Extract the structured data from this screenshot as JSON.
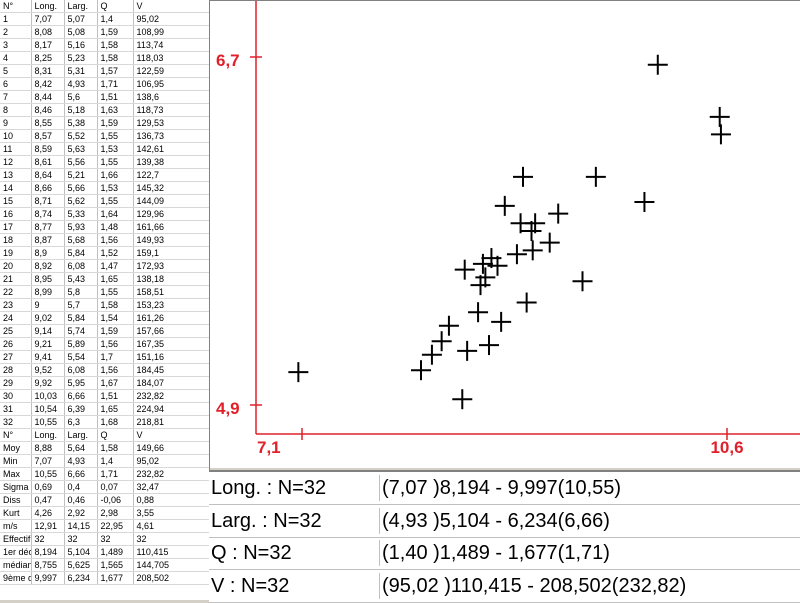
{
  "table": {
    "header": [
      "N°",
      "Long.",
      "Larg.",
      "Q",
      "V"
    ],
    "rows": [
      [
        "1",
        "7,07",
        "5,07",
        "1,4",
        "95,02"
      ],
      [
        "2",
        "8,08",
        "5,08",
        "1,59",
        "108,99"
      ],
      [
        "3",
        "8,17",
        "5,16",
        "1,58",
        "113,74"
      ],
      [
        "4",
        "8,25",
        "5,23",
        "1,58",
        "118,03"
      ],
      [
        "5",
        "8,31",
        "5,31",
        "1,57",
        "122,59"
      ],
      [
        "6",
        "8,42",
        "4,93",
        "1,71",
        "106,95"
      ],
      [
        "7",
        "8,44",
        "5,6",
        "1,51",
        "138,6"
      ],
      [
        "8",
        "8,46",
        "5,18",
        "1,63",
        "118,73"
      ],
      [
        "9",
        "8,55",
        "5,38",
        "1,59",
        "129,53"
      ],
      [
        "10",
        "8,57",
        "5,52",
        "1,55",
        "136,73"
      ],
      [
        "11",
        "8,59",
        "5,63",
        "1,53",
        "142,61"
      ],
      [
        "12",
        "8,61",
        "5,56",
        "1,55",
        "139,38"
      ],
      [
        "13",
        "8,64",
        "5,21",
        "1,66",
        "122,7"
      ],
      [
        "14",
        "8,66",
        "5,66",
        "1,53",
        "145,32"
      ],
      [
        "15",
        "8,71",
        "5,62",
        "1,55",
        "144,09"
      ],
      [
        "16",
        "8,74",
        "5,33",
        "1,64",
        "129,96"
      ],
      [
        "17",
        "8,77",
        "5,93",
        "1,48",
        "161,66"
      ],
      [
        "18",
        "8,87",
        "5,68",
        "1,56",
        "149,93"
      ],
      [
        "19",
        "8,9",
        "5,84",
        "1,52",
        "159,1"
      ],
      [
        "20",
        "8,92",
        "6,08",
        "1,47",
        "172,93"
      ],
      [
        "21",
        "8,95",
        "5,43",
        "1,65",
        "138,18"
      ],
      [
        "22",
        "8,99",
        "5,8",
        "1,55",
        "158,51"
      ],
      [
        "23",
        "9",
        "5,7",
        "1,58",
        "153,23"
      ],
      [
        "24",
        "9,02",
        "5,84",
        "1,54",
        "161,26"
      ],
      [
        "25",
        "9,14",
        "5,74",
        "1,59",
        "157,66"
      ],
      [
        "26",
        "9,21",
        "5,89",
        "1,56",
        "167,35"
      ],
      [
        "27",
        "9,41",
        "5,54",
        "1,7",
        "151,16"
      ],
      [
        "28",
        "9,52",
        "6,08",
        "1,56",
        "184,45"
      ],
      [
        "29",
        "9,92",
        "5,95",
        "1,67",
        "184,07"
      ],
      [
        "30",
        "10,03",
        "6,66",
        "1,51",
        "232,82"
      ],
      [
        "31",
        "10,54",
        "6,39",
        "1,65",
        "224,94"
      ],
      [
        "32",
        "10,55",
        "6,3",
        "1,68",
        "218,81"
      ]
    ],
    "header2": [
      "N°",
      "Long.",
      "Larg.",
      "Q",
      "V"
    ],
    "stats": [
      [
        "Moy",
        "8,88",
        "5,64",
        "1,58",
        "149,66"
      ],
      [
        "Min",
        "7,07",
        "4,93",
        "1,4",
        "95,02"
      ],
      [
        "Max",
        "10,55",
        "6,66",
        "1,71",
        "232,82"
      ],
      [
        "Sigma",
        "0,69",
        "0,4",
        "0,07",
        "32,47"
      ],
      [
        "Diss",
        "0,47",
        "0,46",
        "-0,06",
        "0,88"
      ],
      [
        "Kurt",
        "4,26",
        "2,92",
        "2,98",
        "3,55"
      ],
      [
        "m/s",
        "12,91",
        "14,15",
        "22,95",
        "4,61"
      ],
      [
        "Effectif =",
        "32",
        "32",
        "32",
        "32"
      ],
      [
        "1er décile",
        "8,194",
        "5,104",
        "1,489",
        "110,415"
      ],
      [
        "médiane",
        "8,755",
        "5,625",
        "1,565",
        "144,705"
      ],
      [
        "9ème décile",
        "9,997",
        "6,234",
        "1,677",
        "208,502"
      ]
    ]
  },
  "chart_data": {
    "type": "scatter",
    "x_tick_labels": [
      "7,1",
      "10,6"
    ],
    "y_tick_labels": [
      "6,7",
      "4,9"
    ],
    "xlim": [
      7.1,
      10.6
    ],
    "ylim": [
      4.9,
      6.7
    ],
    "x": [
      7.07,
      8.08,
      8.17,
      8.25,
      8.31,
      8.42,
      8.44,
      8.46,
      8.55,
      8.57,
      8.59,
      8.61,
      8.64,
      8.66,
      8.71,
      8.74,
      8.77,
      8.87,
      8.9,
      8.92,
      8.95,
      8.99,
      9,
      9.02,
      9.14,
      9.21,
      9.41,
      9.52,
      9.92,
      10.03,
      10.54,
      10.55
    ],
    "y": [
      5.07,
      5.08,
      5.16,
      5.23,
      5.31,
      4.93,
      5.6,
      5.18,
      5.38,
      5.52,
      5.63,
      5.56,
      5.21,
      5.66,
      5.62,
      5.33,
      5.93,
      5.68,
      5.84,
      6.08,
      5.43,
      5.8,
      5.7,
      5.84,
      5.74,
      5.89,
      5.54,
      6.08,
      5.95,
      6.66,
      6.39,
      6.3
    ],
    "grid": false,
    "axis_color": "#e0202a",
    "marker_color": "#000000"
  },
  "stats_panel": {
    "rows": [
      {
        "label": "Long. : N=32",
        "range": "(7,07 )8,194 - 9,997(10,55)"
      },
      {
        "label": "Larg. : N=32",
        "range": "(4,93 )5,104 - 6,234(6,66)"
      },
      {
        "label": "Q : N=32",
        "range": "(1,40 )1,489 - 1,677(1,71)"
      },
      {
        "label": "V : N=32",
        "range": "(95,02 )110,415 - 208,502(232,82)"
      }
    ]
  }
}
